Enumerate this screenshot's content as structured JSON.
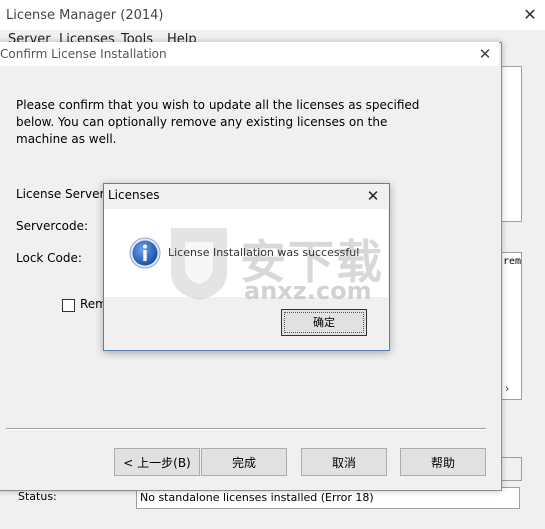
{
  "outer_window": {
    "title": "License Manager (2014)",
    "close_glyph": "✕",
    "menu": [
      "Server",
      "Licenses",
      "Tools",
      "Help"
    ],
    "right_panel_text": "rem",
    "scroll_arrow": "›",
    "status_label": "Status:",
    "status_value": "No standalone licenses installed (Error 18)"
  },
  "confirm_dialog": {
    "title": "Confirm License Installation",
    "close_glyph": "✕",
    "message": [
      "Please confirm that you wish to update all the licenses as specified",
      "below. You can optionally remove any existing licenses on the",
      "machine as well."
    ],
    "labels": {
      "license_server": "License Server:",
      "servercode": "Servercode:",
      "lock_code": "Lock Code:"
    },
    "remove_checkbox_label": "Rem",
    "buttons": {
      "back": "< 上一步(B)",
      "finish": "完成",
      "cancel": "取消",
      "help": "帮助"
    }
  },
  "message_box": {
    "title": "Licenses",
    "close_glyph": "✕",
    "message": "License Installation was successful",
    "ok_label": "确定",
    "icon": "info-icon"
  },
  "watermark": {
    "big_text": "安下载",
    "small_text": "anxz.com"
  }
}
